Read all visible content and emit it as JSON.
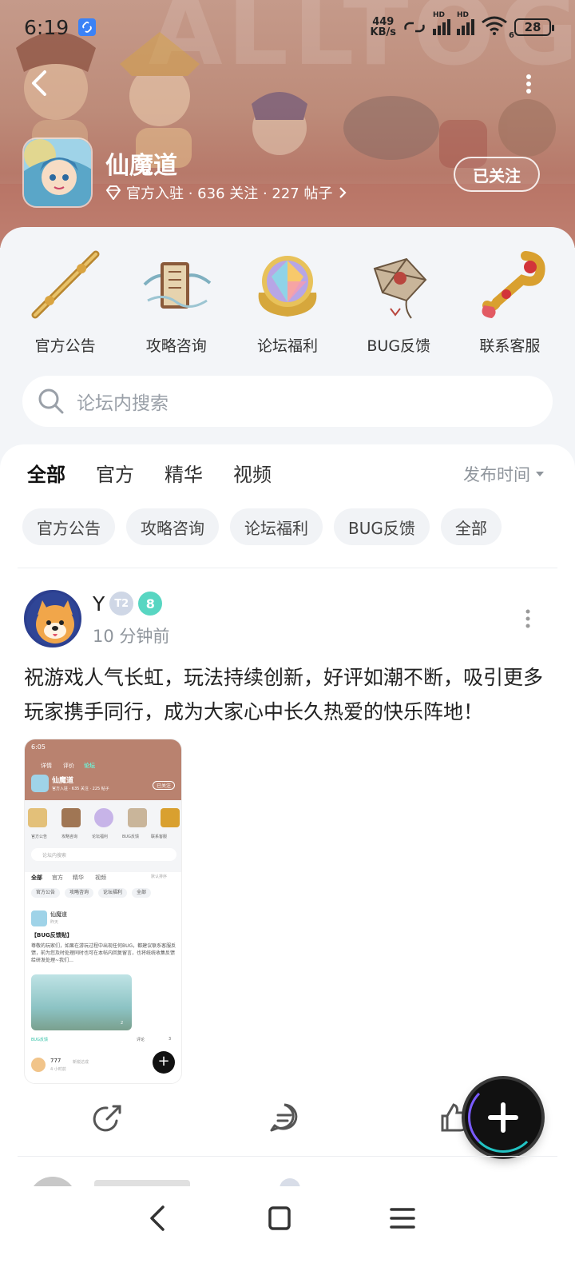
{
  "status_bar": {
    "time": "6:19",
    "net_speed_value": "449",
    "net_speed_unit": "KB/s",
    "signal_label_1": "HD",
    "signal_label_2": "HD",
    "wifi_suffix": "6",
    "battery": "28"
  },
  "header": {
    "forum_name": "仙魔道",
    "meta": "官方入驻 · 636 关注 · 227 帖子",
    "follow_label": "已关注",
    "banner_letters": "ALLTOG"
  },
  "categories": [
    {
      "label": "官方公告",
      "icon": "staff-icon"
    },
    {
      "label": "攻略咨询",
      "icon": "scroll-icon"
    },
    {
      "label": "论坛福利",
      "icon": "gem-icon"
    },
    {
      "label": "BUG反馈",
      "icon": "kite-icon"
    },
    {
      "label": "联系客服",
      "icon": "ruyi-icon"
    }
  ],
  "search": {
    "placeholder": "论坛内搜索"
  },
  "tabs": [
    "全部",
    "官方",
    "精华",
    "视频"
  ],
  "sort_label": "发布时间",
  "chips": [
    "官方公告",
    "攻略咨询",
    "论坛福利",
    "BUG反馈",
    "全部"
  ],
  "post": {
    "username": "Y",
    "badge_t": "T2",
    "badge_level": "8",
    "time": "10 分钟前",
    "text": "祝游戏人气长虹，玩法持续创新，好评如潮不断，吸引更多玩家携手同行，成为大家心中长久热爱的快乐阵地！"
  },
  "thumbnail": {
    "time": "6:05",
    "tab_detail": "详情",
    "tab_review": "评价",
    "tab_forum": "论坛",
    "forum_name": "仙魔道",
    "meta": "官方入驻 · 635 关注 · 225 帖子",
    "follow": "已关注",
    "cats": [
      "官方公告",
      "攻略咨询",
      "论坛福利",
      "BUG反馈",
      "联系客服"
    ],
    "search": "论坛内搜索",
    "tabs": [
      "全部",
      "官方",
      "精华",
      "视频"
    ],
    "sort": "默认排序",
    "chips": [
      "官方公告",
      "攻略咨询",
      "论坛福利",
      "全部"
    ],
    "post_user": "仙魔道",
    "post_time": "昨天",
    "post_title": "【BUG反馈贴】",
    "post_body": "尊敬的玩家们，如果在游玩过程中出现任何BUG，都建议联系客服反馈，前为您及时处理同时也可在本帖内回复留言，也将统统收集反馈给研发处理~我们…",
    "img_count": "2",
    "post_tag": "BUG反馈",
    "comment": "评论",
    "likes": "3",
    "next_user": "777",
    "next_time": "4 小时前",
    "next_badge": "新锐达成"
  },
  "colors": {
    "accent": "#39d6b5",
    "banner": "#bd8b79",
    "panel_bg": "#f3f5f8"
  }
}
